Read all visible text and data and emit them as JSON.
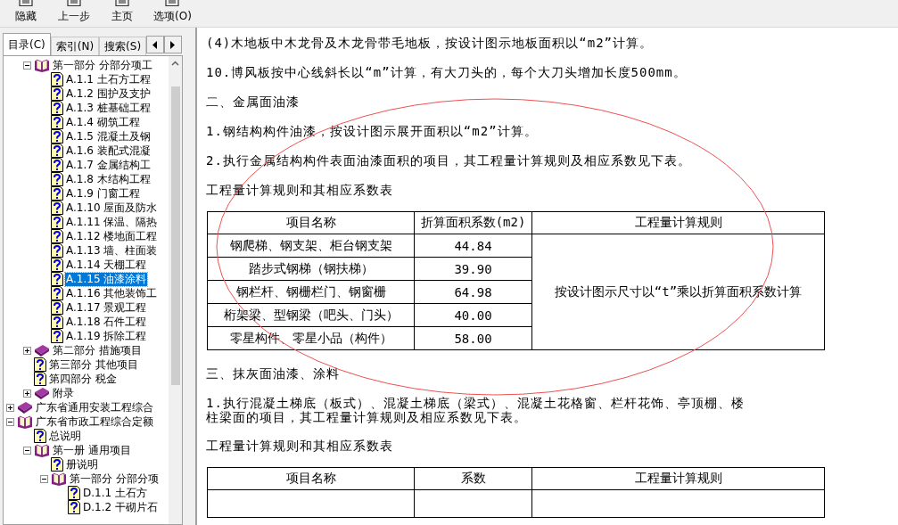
{
  "toolbar": {
    "buttons": [
      {
        "label": "隐藏"
      },
      {
        "label": "上一步"
      },
      {
        "label": "主页"
      },
      {
        "label": "选项(O)"
      }
    ]
  },
  "nav_tabs": [
    {
      "label": "目录(C)",
      "selected": true
    },
    {
      "label": "索引(N)",
      "selected": false
    },
    {
      "label": "搜索(S)",
      "selected": false
    }
  ],
  "tree": {
    "continued_items": [
      {
        "label": "第一部分 分部分项工",
        "kind": "book",
        "expanded": true,
        "selected": false,
        "children": [
          {
            "label": "A.1.1 土石方工程",
            "kind": "page",
            "selected": false
          },
          {
            "label": "A.1.2 围护及支护",
            "kind": "page",
            "selected": false
          },
          {
            "label": "A.1.3 桩基础工程",
            "kind": "page",
            "selected": false
          },
          {
            "label": "A.1.4 砌筑工程",
            "kind": "page",
            "selected": false
          },
          {
            "label": "A.1.5 混凝土及钢",
            "kind": "page",
            "selected": false
          },
          {
            "label": "A.1.6 装配式混凝",
            "kind": "page",
            "selected": false
          },
          {
            "label": "A.1.7 金属结构工",
            "kind": "page",
            "selected": false
          },
          {
            "label": "A.1.8 木结构工程",
            "kind": "page",
            "selected": false
          },
          {
            "label": "A.1.9 门窗工程",
            "kind": "page",
            "selected": false
          },
          {
            "label": "A.1.10 屋面及防水",
            "kind": "page",
            "selected": false
          },
          {
            "label": "A.1.11 保温、隔热",
            "kind": "page",
            "selected": false
          },
          {
            "label": "A.1.12 楼地面工程",
            "kind": "page",
            "selected": false
          },
          {
            "label": "A.1.13 墙、柱面装",
            "kind": "page",
            "selected": false
          },
          {
            "label": "A.1.14 天棚工程",
            "kind": "page",
            "selected": false
          },
          {
            "label": "A.1.15 油漆涂料",
            "kind": "page",
            "selected": true
          },
          {
            "label": "A.1.16 其他装饰工",
            "kind": "page",
            "selected": false
          },
          {
            "label": "A.1.17 景观工程",
            "kind": "page",
            "selected": false
          },
          {
            "label": "A.1.18 石件工程",
            "kind": "page",
            "selected": false
          },
          {
            "label": "A.1.19 拆除工程",
            "kind": "page",
            "selected": false
          }
        ]
      },
      {
        "label": "第二部分 措施项目",
        "kind": "book",
        "expanded": false,
        "selected": false
      },
      {
        "label": "第三部分 其他项目",
        "kind": "page",
        "selected": false
      },
      {
        "label": "第四部分 税金",
        "kind": "page",
        "selected": false
      },
      {
        "label": "附录",
        "kind": "book",
        "expanded": false,
        "selected": false
      }
    ],
    "items": [
      {
        "label": "广东省通用安装工程综合",
        "kind": "book",
        "expanded": false,
        "selected": false
      },
      {
        "label": "广东省市政工程综合定额",
        "kind": "book",
        "expanded": true,
        "selected": false,
        "children": [
          {
            "label": "总说明",
            "kind": "page",
            "selected": false
          },
          {
            "label": "第一册 通用项目",
            "kind": "book",
            "expanded": true,
            "selected": false,
            "children": [
              {
                "label": "册说明",
                "kind": "page",
                "selected": false
              },
              {
                "label": "第一部分 分部分项",
                "kind": "book",
                "expanded": true,
                "selected": false,
                "children": [
                  {
                    "label": "D.1.1 土石方",
                    "kind": "page",
                    "selected": false
                  },
                  {
                    "label": "D.1.2 干砌片石",
                    "kind": "page",
                    "selected": false
                  }
                ]
              }
            ]
          }
        ]
      }
    ]
  },
  "content": {
    "blocks": [
      {
        "kind": "para",
        "lines": [
          "(4)木地板中木龙骨及木龙骨带毛地板，按设计图示地板面积以“m2”计算。"
        ]
      },
      {
        "kind": "para",
        "lines": [
          "10.博风板按中心线斜长以“m”计算，有大刀头的，每个大刀头增加长度500mm。"
        ]
      },
      {
        "kind": "para",
        "lines": [
          "二、金属面油漆"
        ]
      },
      {
        "kind": "para",
        "lines": [
          "1.钢结构构件油漆，按设计图示展开面积以“m2”计算。"
        ]
      },
      {
        "kind": "para",
        "lines": [
          "2.执行金属结构构件表面油漆面积的项目，其工程量计算规则及相应系数见下表。"
        ]
      },
      {
        "kind": "para",
        "lines": [
          "工程量计算规则和其相应系数表"
        ]
      },
      {
        "kind": "table",
        "columns": [
          "项目名称",
          "折算面积系数(m2)",
          "工程量计算规则"
        ],
        "rule": "按设计图示尺寸以“t”乘以折算面积系数计算",
        "rows": [
          [
            "钢爬梯、钢支架、柜台钢支架",
            "44.84"
          ],
          [
            "踏步式钢梯（钢扶梯）",
            "39.90"
          ],
          [
            "钢栏杆、钢栅栏门、钢窗栅",
            "64.98"
          ],
          [
            "桁架梁、型钢梁（吧头、门头）",
            "40.00"
          ],
          [
            "零星构件、零星小品（构件）",
            "58.00"
          ]
        ]
      },
      {
        "kind": "para",
        "lines": [
          "三、抹灰面油漆、涂料"
        ]
      },
      {
        "kind": "para",
        "lines": [
          "1.执行混凝土梯底（板式）、混凝土梯底（梁式）、混凝土花格窗、栏杆花饰、亭顶棚、楼",
          "柱梁面的项目，其工程量计算规则及相应系数见下表。"
        ]
      },
      {
        "kind": "para",
        "lines": [
          "工程量计算规则和其相应系数表"
        ]
      },
      {
        "kind": "table",
        "columns": [
          "项目名称",
          "系数",
          "工程量计算规则"
        ]
      }
    ]
  }
}
